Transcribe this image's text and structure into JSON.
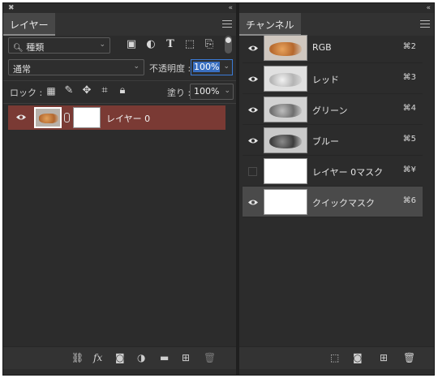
{
  "layers_panel": {
    "tab": "レイヤー",
    "filter_kind": "種類",
    "blend_mode": "通常",
    "opacity_label": "不透明度 :",
    "opacity_value": "100%",
    "lock_label": "ロック :",
    "fill_label": "塗り :",
    "fill_value": "100%",
    "layer_name": "レイヤー 0",
    "footer_fx": "fx"
  },
  "channels_panel": {
    "tab": "チャンネル",
    "channels": [
      {
        "name": "RGB",
        "shortcut": "⌘2",
        "visible": true
      },
      {
        "name": "レッド",
        "shortcut": "⌘3",
        "visible": true
      },
      {
        "name": "グリーン",
        "shortcut": "⌘4",
        "visible": true
      },
      {
        "name": "ブルー",
        "shortcut": "⌘5",
        "visible": true
      },
      {
        "name": "レイヤー 0マスク",
        "shortcut": "⌘¥",
        "visible": false
      },
      {
        "name": "クイックマスク",
        "shortcut": "⌘6",
        "visible": true
      }
    ]
  },
  "colors": {
    "selected_layer": "#7a3a34",
    "selected_channel": "#4a4a4a",
    "panel_bg": "#2c2c2c"
  }
}
